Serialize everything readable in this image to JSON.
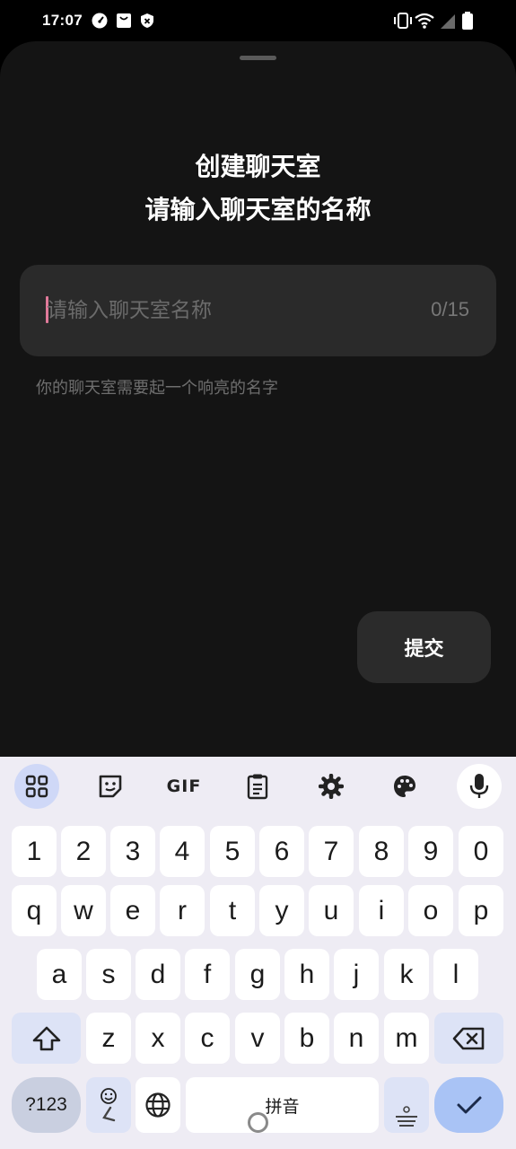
{
  "status_bar": {
    "time": "17:07",
    "left_icons": [
      "speedometer-icon",
      "bag-icon",
      "shield-icon"
    ],
    "right_icons": [
      "vibrate-icon",
      "wifi-icon",
      "signal-icon",
      "battery-icon"
    ]
  },
  "sheet": {
    "title_line1": "创建聊天室",
    "title_line2": "请输入聊天室的名称",
    "input": {
      "placeholder": "请输入聊天室名称",
      "value": "",
      "counter": "0/15"
    },
    "hint": "你的聊天室需要起一个响亮的名字",
    "submit_label": "提交"
  },
  "keyboard": {
    "toolbar": [
      "apps-icon",
      "sticker-icon",
      "gif-icon",
      "clipboard-icon",
      "settings-icon",
      "palette-icon",
      "mic-icon"
    ],
    "gif_label": "GIF",
    "row_numbers": [
      "1",
      "2",
      "3",
      "4",
      "5",
      "6",
      "7",
      "8",
      "9",
      "0"
    ],
    "row1": [
      "q",
      "w",
      "e",
      "r",
      "t",
      "y",
      "u",
      "i",
      "o",
      "p"
    ],
    "row2": [
      "a",
      "s",
      "d",
      "f",
      "g",
      "h",
      "j",
      "k",
      "l"
    ],
    "row3": [
      "z",
      "x",
      "c",
      "v",
      "b",
      "n",
      "m"
    ],
    "symbols_label": "?123",
    "space_label": "拼音",
    "accent_color": "#a9c3f5"
  }
}
